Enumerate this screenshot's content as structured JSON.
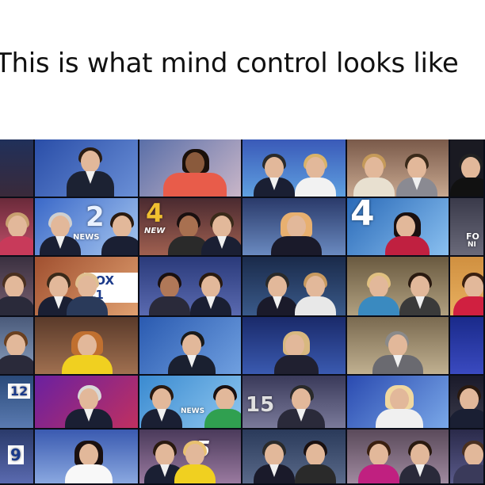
{
  "headline": {
    "text": "This is what mind control looks like"
  },
  "logos": {
    "cbs2": "2",
    "cbs2_news": "NEWS",
    "ch4": "4",
    "ch4_news": "NEW",
    "fox11": "FOX 11",
    "fox_top_right": "FO",
    "fox_top_right2": "NI",
    "ch12": "12",
    "ch15": "15",
    "ch9": "9",
    "ch5": "5",
    "ch4b": "4",
    "nbc_news": "NEWS"
  },
  "colors": {
    "background": "#ffffff",
    "headline_text": "#111111",
    "mosaic_bg": "#0b0f1e"
  }
}
